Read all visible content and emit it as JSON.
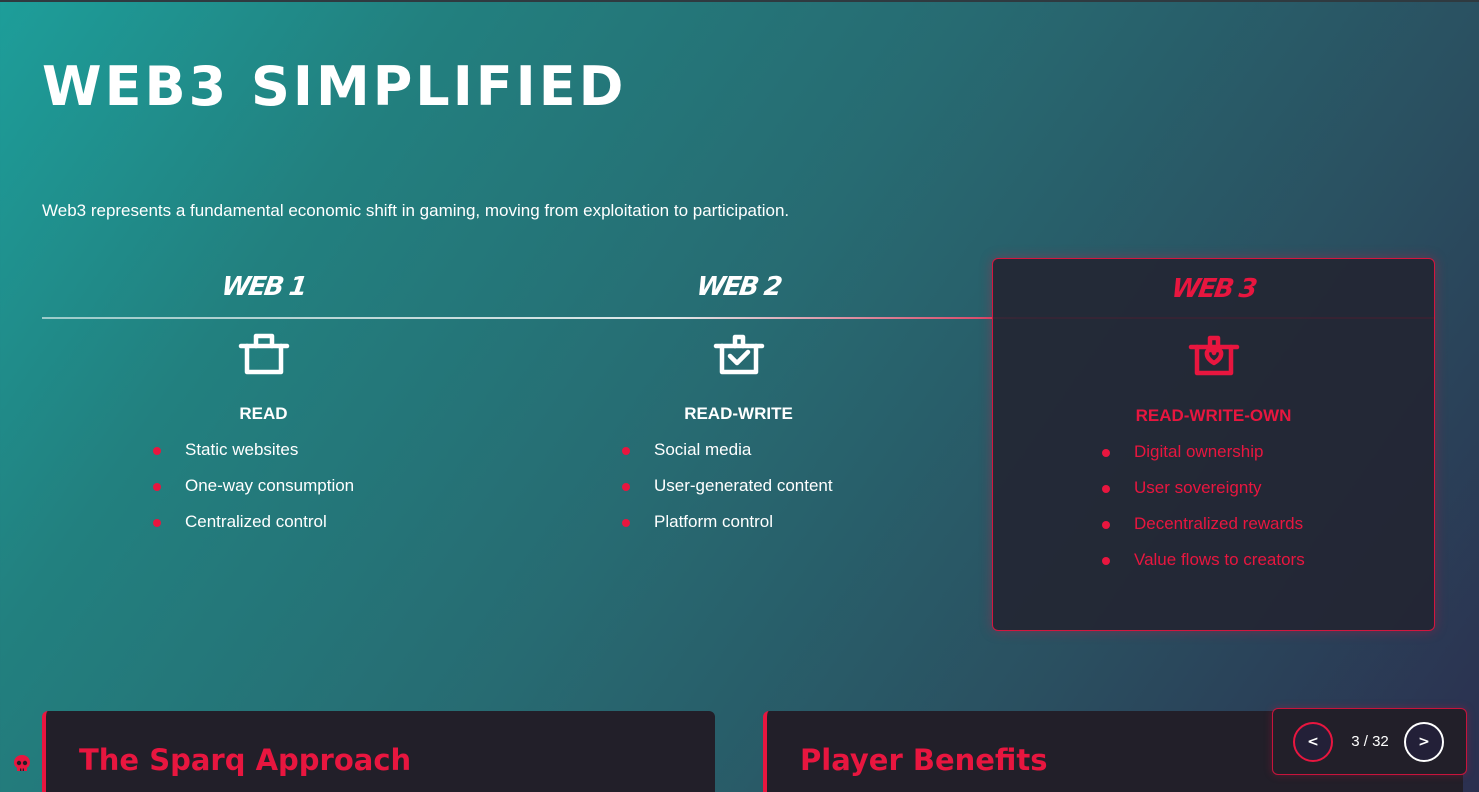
{
  "page": {
    "title": "WEB3 SIMPLIFIED",
    "subtitle": "Web3 represents a fundamental economic shift in gaming, moving from exploitation to participation."
  },
  "eras": [
    {
      "name": "WEB 1",
      "icon": "basket-icon",
      "level": "READ",
      "points": [
        "Static websites",
        "One-way consumption",
        "Centralized control"
      ]
    },
    {
      "name": "WEB 2",
      "icon": "basket-check-icon",
      "level": "READ-WRITE",
      "points": [
        "Social media",
        "User-generated content",
        "Platform control"
      ]
    },
    {
      "name": "WEB 3",
      "icon": "basket-heart-icon",
      "level": "READ-WRITE-OWN",
      "highlighted": true,
      "points": [
        "Digital ownership",
        "User sovereignty",
        "Decentralized rewards",
        "Value flows to creators"
      ]
    }
  ],
  "cards": [
    {
      "title": "The Sparq Approach"
    },
    {
      "title": "Player Benefits"
    }
  ],
  "pager": {
    "prev_label": "<",
    "next_label": ">",
    "count": "3 / 32"
  },
  "colors": {
    "accent": "#e8163f",
    "card_bg": "#221f29",
    "bg_start": "#1d9e9a",
    "bg_end": "#2b2f4f"
  }
}
